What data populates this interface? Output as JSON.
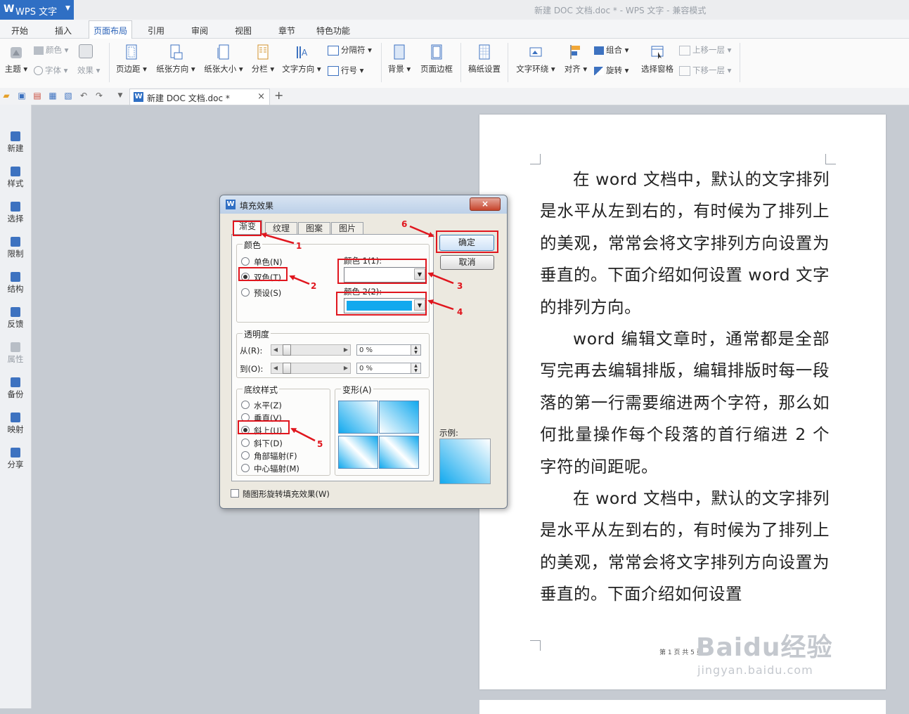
{
  "app": {
    "name": "WPS 文字",
    "window_title": "新建 DOC 文档.doc * - WPS 文字 - 兼容模式"
  },
  "menu": {
    "tabs": [
      "开始",
      "插入",
      "页面布局",
      "引用",
      "审阅",
      "视图",
      "章节",
      "特色功能"
    ],
    "active": "页面布局"
  },
  "ribbon": {
    "theme": "主题",
    "color": "颜色",
    "font": "字体",
    "effect": "效果",
    "margins": "页边距",
    "orientation": "纸张方向",
    "size": "纸张大小",
    "columns": "分栏",
    "text_direction": "文字方向",
    "breaks": "分隔符",
    "line_numbers": "行号",
    "background": "背景",
    "page_border": "页面边框",
    "draft_settings": "稿纸设置",
    "wrap_text": "文字环绕",
    "align": "对齐",
    "group": "组合",
    "rotate": "旋转",
    "selection_pane": "选择窗格",
    "bring_forward": "上移一层",
    "send_backward": "下移一层"
  },
  "doc_tab": {
    "name": "新建 DOC 文档.doc *",
    "close": "×",
    "new": "+"
  },
  "sidebar": {
    "items": [
      "新建",
      "样式",
      "选择",
      "限制",
      "结构",
      "反馈",
      "属性",
      "备份",
      "映射",
      "分享"
    ]
  },
  "document": {
    "paragraphs": [
      "在 word 文档中，默认的文字排列是水平从左到右的，有时候为了排列上的美观，常常会将文字排列方向设置为垂直的。下面介绍如何设置 word 文字的排列方向。",
      "word 编辑文章时，通常都是全部写完再去编辑排版，编辑排版时每一段落的第一行需要缩进两个字符，那么如何批量操作每个段落的首行缩进 2 个字符的间距呢。",
      "在 word 文档中，默认的文字排列是水平从左到右的，有时候为了排列上的美观，常常会将文字排列方向设置为垂直的。下面介绍如何设置"
    ],
    "footer": "第 1 页 共 5 页"
  },
  "watermark": {
    "main": "Baidu经验",
    "sub": "jingyan.baidu.com"
  },
  "dialog": {
    "title": "填充效果",
    "close": "×",
    "tabs": [
      "渐变",
      "纹理",
      "图案",
      "图片"
    ],
    "colors": {
      "group": "颜色",
      "one": "单色(N)",
      "two": "双色(T)",
      "preset": "预设(S)",
      "color1_label": "颜色 1(1):",
      "color2_label": "颜色 2(2):"
    },
    "transparency": {
      "group": "透明度",
      "from": "从(R):",
      "to": "到(O):",
      "from_value": "0 %",
      "to_value": "0 %"
    },
    "shading": {
      "group": "底纹样式",
      "styles": [
        "水平(Z)",
        "垂直(V)",
        "斜上(U)",
        "斜下(D)",
        "角部辐射(F)",
        "中心辐射(M)"
      ],
      "selected": "斜上(U)"
    },
    "variants_label": "变形(A)",
    "ok": "确定",
    "cancel": "取消",
    "sample": "示例:",
    "rotate_with_shape": "随图形旋转填充效果(W)",
    "color1": "#ffffff",
    "color2": "#12a9ee"
  },
  "annotations": [
    "1",
    "2",
    "3",
    "4",
    "5",
    "6"
  ],
  "colors": {
    "accent": "#2f6fc4",
    "annotation": "#e0161e"
  }
}
